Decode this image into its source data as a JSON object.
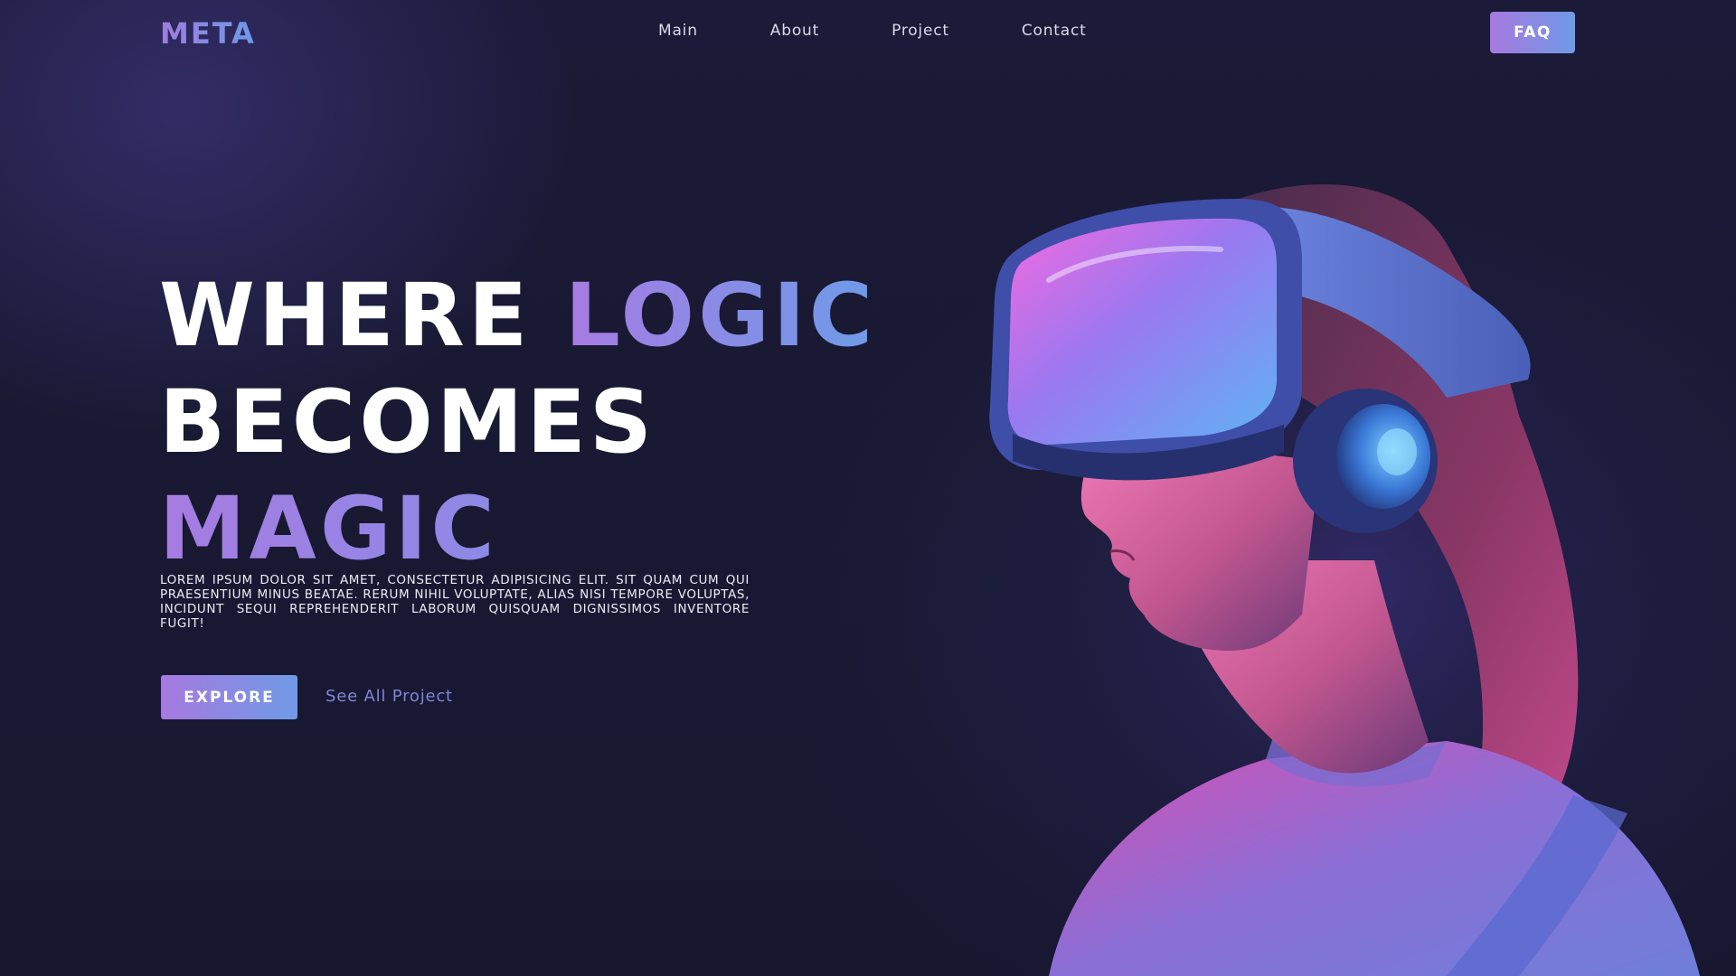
{
  "brand": {
    "logo_text": "META"
  },
  "nav": {
    "items": [
      {
        "label": "Main"
      },
      {
        "label": "About"
      },
      {
        "label": "Project"
      },
      {
        "label": "Contact"
      }
    ],
    "cta_label": "FAQ"
  },
  "hero": {
    "headline": {
      "line1_plain": "WHERE",
      "line1_accent": "LOGIC",
      "line2": "BECOMES",
      "line3_accent": "MAGIC"
    },
    "description": "Lorem ipsum dolor sit amet, consectetur adipisicing elit. Sit quam cum qui praesentium minus beatae. Rerum nihil voluptate, alias nisi tempore voluptas, incidunt sequi reprehenderit laborum quisquam dignissimos inventore fugit!",
    "primary_button": "EXPLORE",
    "secondary_link": "See All Project",
    "image_subject": "woman-wearing-vr-headset"
  },
  "colors": {
    "background": "#171730",
    "accent_start": "#a779df",
    "accent_end": "#6f9ae6",
    "link": "#7f84d6"
  }
}
